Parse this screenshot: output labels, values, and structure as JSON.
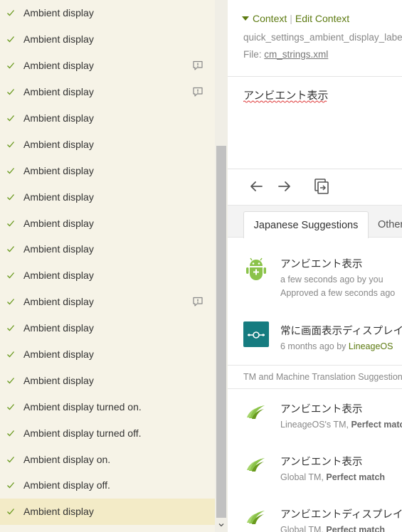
{
  "list": {
    "items": [
      {
        "label": "Ambient display",
        "warning": false,
        "selected": false
      },
      {
        "label": "Ambient display",
        "warning": false,
        "selected": false
      },
      {
        "label": "Ambient display",
        "warning": true,
        "selected": false
      },
      {
        "label": "Ambient display",
        "warning": true,
        "selected": false
      },
      {
        "label": "Ambient display",
        "warning": false,
        "selected": false
      },
      {
        "label": "Ambient display",
        "warning": false,
        "selected": false
      },
      {
        "label": "Ambient display",
        "warning": false,
        "selected": false
      },
      {
        "label": "Ambient display",
        "warning": false,
        "selected": false
      },
      {
        "label": "Ambient display",
        "warning": false,
        "selected": false
      },
      {
        "label": "Ambient display",
        "warning": false,
        "selected": false
      },
      {
        "label": "Ambient display",
        "warning": false,
        "selected": false
      },
      {
        "label": "Ambient display",
        "warning": true,
        "selected": false
      },
      {
        "label": "Ambient display",
        "warning": false,
        "selected": false
      },
      {
        "label": "Ambient display",
        "warning": false,
        "selected": false
      },
      {
        "label": "Ambient display",
        "warning": false,
        "selected": false
      },
      {
        "label": "Ambient display turned on.",
        "warning": false,
        "selected": false
      },
      {
        "label": "Ambient display turned off.",
        "warning": false,
        "selected": false
      },
      {
        "label": "Ambient display on.",
        "warning": false,
        "selected": false
      },
      {
        "label": "Ambient display off.",
        "warning": false,
        "selected": false
      },
      {
        "label": "Ambient display",
        "warning": false,
        "selected": true
      }
    ]
  },
  "context": {
    "toggle_label": "Context",
    "edit_label": "Edit Context",
    "key": "quick_settings_ambient_display_label",
    "file_prefix": "File: ",
    "file_name": "cm_strings.xml"
  },
  "editor": {
    "translation": "アンビエント表示"
  },
  "tabs": {
    "active": "Japanese Suggestions",
    "other": "Other"
  },
  "suggestions": [
    {
      "text": "アンビエント表示",
      "meta1": "a few seconds ago by you",
      "meta2": "Approved a few seconds ago",
      "icon": "android-icon"
    },
    {
      "text": "常に画面表示ディスプレイ",
      "meta_prefix": "6 months ago by ",
      "meta_link": "LineageOS",
      "icon": "lineageos-icon"
    }
  ],
  "tm_section": {
    "header": "TM and Machine Translation Suggestions",
    "items": [
      {
        "text": "アンビエント表示",
        "source": "LineageOS's TM, ",
        "match": "Perfect match"
      },
      {
        "text": "アンビエント表示",
        "source": "Global TM, ",
        "match": "Perfect match"
      },
      {
        "text": "アンビエントディスプレイ",
        "source": "Global TM, ",
        "match": "Perfect match"
      }
    ]
  },
  "colors": {
    "accent": "#5c7a10",
    "check": "#6a9a1f",
    "list_bg": "#f6f3e7",
    "selected_bg": "#f3ebc7"
  }
}
